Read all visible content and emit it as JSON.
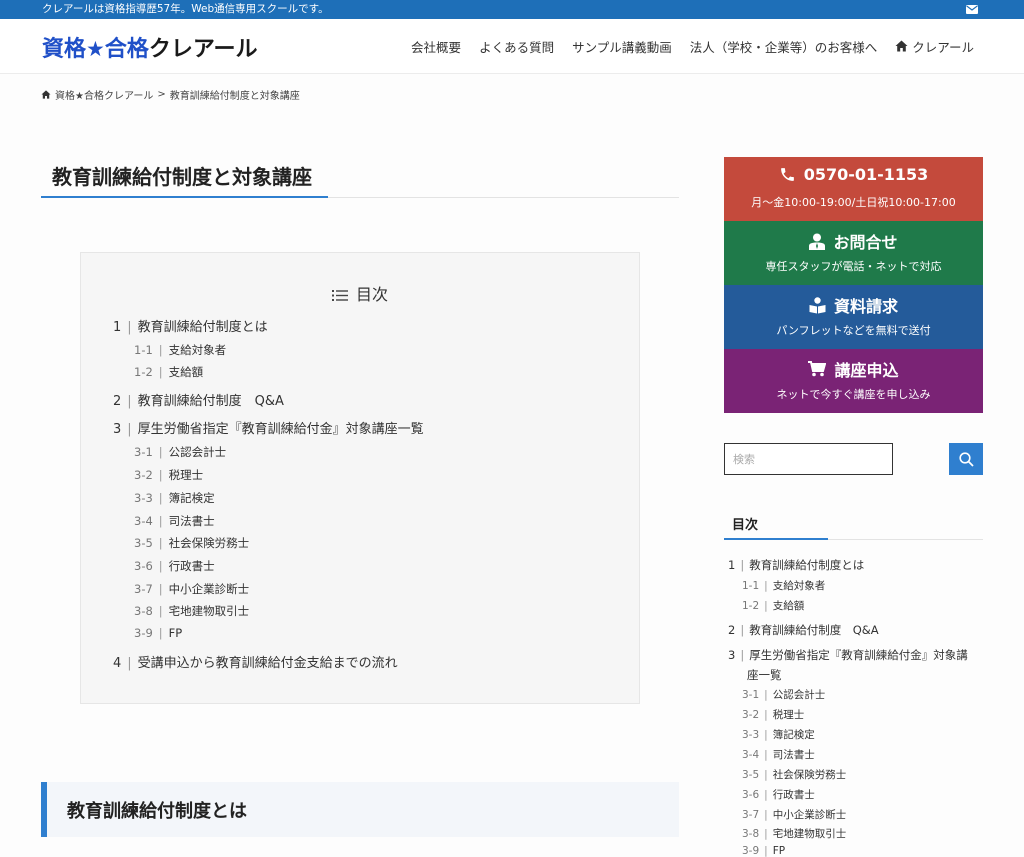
{
  "topbar": {
    "notice": "クレアールは資格指導歴57年。Web通信専用スクールです。"
  },
  "header": {
    "logo": {
      "part1": "資格",
      "star": "★",
      "part2": "合格",
      "part3": "クレアール"
    },
    "nav": [
      "会社概要",
      "よくある質問",
      "サンプル講義動画",
      "法人（学校・企業等）のお客様へ",
      "クレアール"
    ]
  },
  "breadcrumb": {
    "home": "資格★合格クレアール",
    "separator": ">",
    "current": "教育訓練給付制度と対象講座"
  },
  "page_title": "教育訓練給付制度と対象講座",
  "toc": {
    "title": "目次",
    "items": [
      {
        "num": "1",
        "label": "教育訓練給付制度とは"
      },
      {
        "num": "1-1",
        "label": "支給対象者"
      },
      {
        "num": "1-2",
        "label": "支給額"
      },
      {
        "num": "2",
        "label": "教育訓練給付制度　Q&A"
      },
      {
        "num": "3",
        "label": "厚生労働省指定『教育訓練給付金』対象講座一覧"
      },
      {
        "num": "3-1",
        "label": "公認会計士"
      },
      {
        "num": "3-2",
        "label": "税理士"
      },
      {
        "num": "3-3",
        "label": "簿記検定"
      },
      {
        "num": "3-4",
        "label": "司法書士"
      },
      {
        "num": "3-5",
        "label": "社会保険労務士"
      },
      {
        "num": "3-6",
        "label": "行政書士"
      },
      {
        "num": "3-7",
        "label": "中小企業診断士"
      },
      {
        "num": "3-8",
        "label": "宅地建物取引士"
      },
      {
        "num": "3-9",
        "label": "FP"
      },
      {
        "num": "4",
        "label": "受講申込から教育訓練給付金支給までの流れ"
      }
    ]
  },
  "section_heading": "教育訓練給付制度とは",
  "sidebar": {
    "cta": {
      "phone": {
        "main": "0570-01-1153",
        "sub": "月～金10:00-19:00/土日祝10:00-17:00",
        "color": "#c44a3c"
      },
      "contact": {
        "main": "お問合せ",
        "sub": "専任スタッフが電話・ネットで対応",
        "color": "#1f7a4a"
      },
      "docs": {
        "main": "資料請求",
        "sub": "パンフレットなどを無料で送付",
        "color": "#245b9a"
      },
      "apply": {
        "main": "講座申込",
        "sub": "ネットで今すぐ講座を申し込み",
        "color": "#7a2375"
      }
    },
    "search": {
      "placeholder": "検索"
    },
    "toc_title": "目次",
    "toc": {
      "i0": {
        "num": "1",
        "label": "教育訓練給付制度とは"
      },
      "i1": {
        "num": "1-1",
        "label": "支給対象者"
      },
      "i2": {
        "num": "1-2",
        "label": "支給額"
      },
      "i3": {
        "num": "2",
        "label": "教育訓練給付制度　Q&A"
      },
      "i4": {
        "num": "3",
        "label": "厚生労働省指定『教育訓練給付金』対象講",
        "label_cont": "座一覧"
      },
      "i5": {
        "num": "3-1",
        "label": "公認会計士"
      },
      "i6": {
        "num": "3-2",
        "label": "税理士"
      },
      "i7": {
        "num": "3-3",
        "label": "簿記検定"
      },
      "i8": {
        "num": "3-4",
        "label": "司法書士"
      },
      "i9": {
        "num": "3-5",
        "label": "社会保険労務士"
      },
      "i10": {
        "num": "3-6",
        "label": "行政書士"
      },
      "i11": {
        "num": "3-7",
        "label": "中小企業診断士"
      },
      "i12": {
        "num": "3-8",
        "label": "宅地建物取引士"
      },
      "i13": {
        "num": "3-9",
        "label": "FP"
      }
    }
  },
  "colors": {
    "accent": "#2f7fcf",
    "topbar": "#1e6fb8",
    "logo_blue": "#2050c8"
  }
}
